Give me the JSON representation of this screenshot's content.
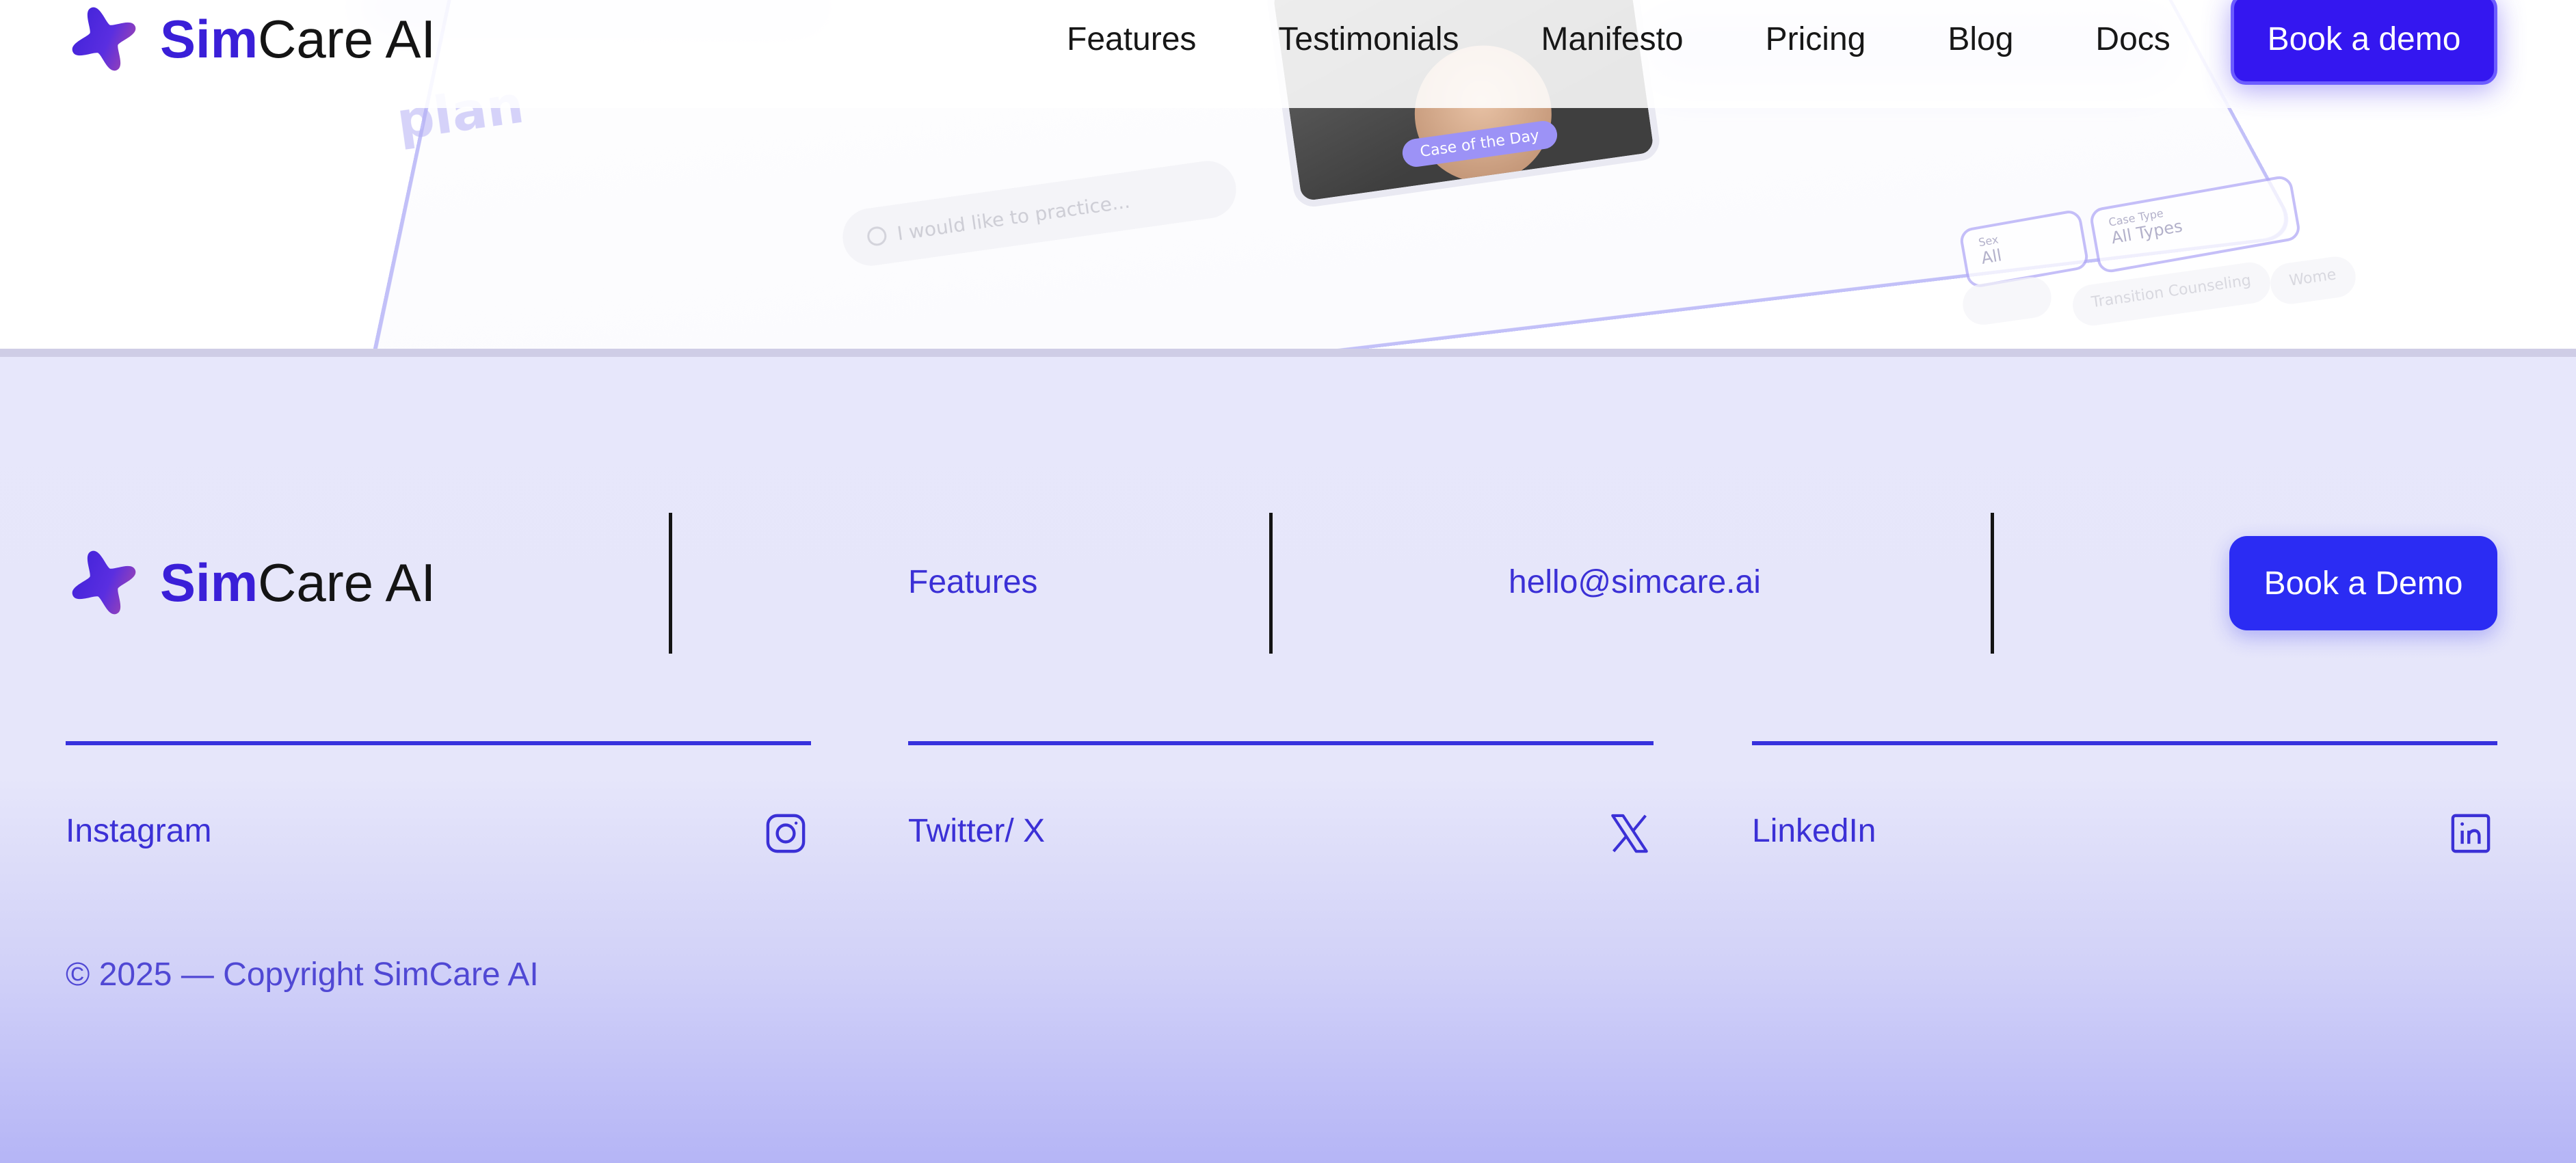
{
  "brand": {
    "name_accent": "Sim",
    "name_rest": "Care AI",
    "colors": {
      "accent": "#3a1fd8",
      "gradient_start": "#3a1fd8",
      "gradient_end": "#c0509a"
    }
  },
  "navbar": {
    "links": [
      "Features",
      "Testimonials",
      "Manifesto",
      "Pricing",
      "Blog",
      "Docs"
    ],
    "cta_label": "Book a demo",
    "cta_color": "#3417f0"
  },
  "hero_mockup": {
    "title_fragment": "plan",
    "search_placeholder": "I would like to practice...",
    "case_badge": "Case of the Day",
    "filters": [
      {
        "label": "Sex",
        "value": "All"
      },
      {
        "label": "Case Type",
        "value": "All Types"
      }
    ],
    "tags": [
      "Transition Counseling",
      "Wome"
    ]
  },
  "footer": {
    "features_link": "Features",
    "email": "hello@simcare.ai",
    "cta_label": "Book a Demo",
    "cta_color": "#2b2cf3",
    "social": [
      {
        "label": "Instagram",
        "icon": "instagram-icon"
      },
      {
        "label": "Twitter/ X",
        "icon": "x-icon"
      },
      {
        "label": "LinkedIn",
        "icon": "linkedin-icon"
      }
    ],
    "copyright": "© 2025 — Copyright SimCare AI",
    "link_color": "#3b30d6"
  }
}
